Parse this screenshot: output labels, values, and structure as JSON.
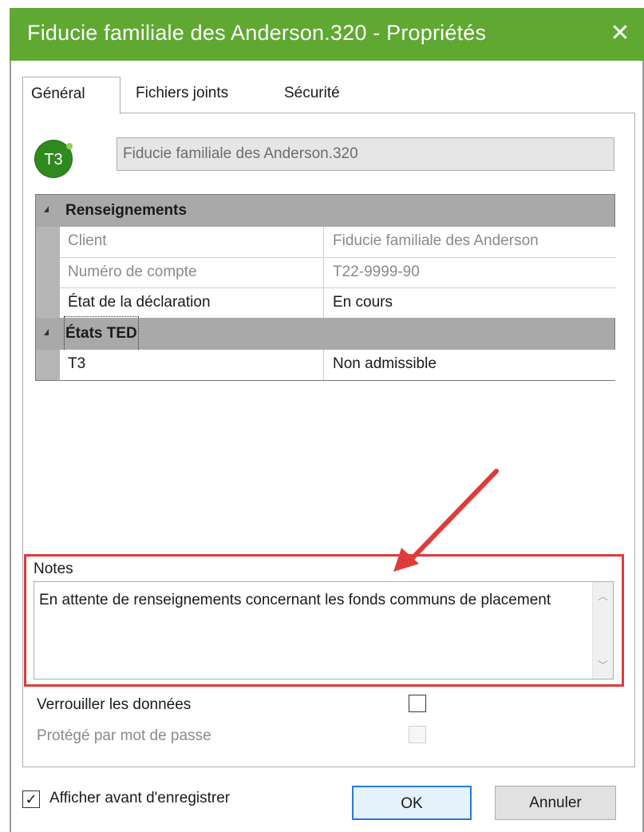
{
  "window": {
    "title": "Fiducie familiale des Anderson.320 - Propriétés",
    "close_icon": "close-icon",
    "title_bar_color": "#5fa832"
  },
  "tabs": [
    {
      "label": "Général",
      "active": true
    },
    {
      "label": "Fichiers joints",
      "active": false
    },
    {
      "label": "Sécurité",
      "active": false
    }
  ],
  "header": {
    "badge": "T3",
    "file_name": "Fiducie familiale des Anderson.320"
  },
  "properties": {
    "sections": [
      {
        "label": "Renseignements",
        "rows": [
          {
            "key": "Client",
            "value": "Fiducie familiale des Anderson",
            "readonly": true
          },
          {
            "key": "Numéro de compte",
            "value": "T22-9999-90",
            "readonly": true
          },
          {
            "key": "État de la déclaration",
            "value": "En cours",
            "readonly": false
          }
        ]
      },
      {
        "label": "États TED",
        "rows": [
          {
            "key": "T3",
            "value": "Non admissible",
            "readonly": false
          }
        ]
      }
    ]
  },
  "notes": {
    "label": "Notes",
    "text": "En attente de renseignements concernant les fonds communs de placement"
  },
  "options": {
    "lock_label": "Verrouiller les données",
    "lock_checked": false,
    "password_label": "Protégé par mot de passe",
    "password_checked": false,
    "password_enabled": false
  },
  "footer": {
    "show_before_save_label": "Afficher avant d'enregistrer",
    "show_before_save_checked": true,
    "check_mark": "✓",
    "ok_label": "OK",
    "cancel_label": "Annuler"
  },
  "annotation": {
    "highlight_color": "#e03b3b"
  }
}
